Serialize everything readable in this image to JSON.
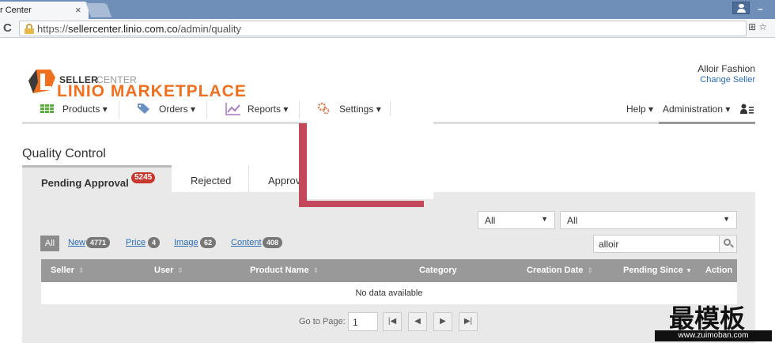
{
  "browser": {
    "tab_title": "r Center",
    "tab_close": "×",
    "url_prefix": "https://",
    "url_host": "sellercenter.linio.com.co",
    "url_path": "/admin/quality",
    "addr_icons": "⊞ ☆"
  },
  "logo": {
    "seller": "SELLER",
    "center": "CENTER",
    "linio": "LINIO MARKETPLACE"
  },
  "user": {
    "name": "Alloir Fashion",
    "change_seller": "Change Seller"
  },
  "nav": {
    "products": "Products ▾",
    "orders": "Orders ▾",
    "reports": "Reports ▾",
    "settings": "Settings ▾",
    "help": "Help ▾",
    "administration": "Administration ▾"
  },
  "page": {
    "title": "Quality Control"
  },
  "tabs": [
    {
      "label": "Pending Approval",
      "badge": "5245"
    },
    {
      "label": "Rejected"
    },
    {
      "label": "Approv"
    }
  ],
  "dropdowns": [
    {
      "value": "All"
    },
    {
      "value": "All"
    }
  ],
  "filters": {
    "all": "All",
    "items": [
      {
        "label": "New",
        "count": "4771"
      },
      {
        "label": "Price",
        "count": "4"
      },
      {
        "label": "Image",
        "count": "62"
      },
      {
        "label": "Content",
        "count": "408"
      }
    ]
  },
  "search": {
    "value": "alloir"
  },
  "table": {
    "headers": [
      "Seller",
      "User",
      "Product Name",
      "Category",
      "Creation Date",
      "Pending Since",
      "Action"
    ],
    "sort_glyph": "⇕",
    "sort_desc": "▾",
    "empty": "No data available"
  },
  "pager": {
    "label": "Go to Page:",
    "value": "1",
    "first": "|◀",
    "prev": "◀",
    "next": "▶",
    "last": "▶|"
  },
  "watermark": {
    "text": "最模板",
    "url": "www.zuimoban.com"
  },
  "colors": {
    "brand_orange": "#f07020",
    "link_blue": "#2a6cb3",
    "badge_red": "#c8372c",
    "annotation_red": "#c2485a"
  }
}
